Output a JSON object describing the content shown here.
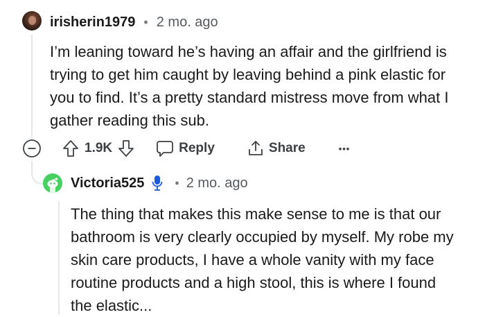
{
  "comment": {
    "username": "irisherin1979",
    "time": "2 mo. ago",
    "body": "I’m leaning toward he’s having an affair and the girlfriend is trying to get him caught by leaving behind a pink elastic for you to find. It’s a pretty standard mistress move from what I gather reading this sub.",
    "votes": "1.9K",
    "reply_label": "Reply",
    "share_label": "Share",
    "more_label": "•••"
  },
  "reply": {
    "username": "Victoria525",
    "time": "2 mo. ago",
    "body": "The thing that makes this make sense to me is that our bathroom is very clearly occupied by myself. My robe my skin care products, I have a whole vanity with my face routine products and a high stool, this is where I found the elastic..."
  },
  "colors": {
    "text": "#1a1a1b",
    "muted": "#555a5e",
    "thread": "#e5e7ea",
    "badge_blue": "#1e5bd8",
    "avatar_green": "#46d160"
  },
  "icons": [
    "collapse-icon",
    "upvote-icon",
    "downvote-icon",
    "reply-icon",
    "share-icon",
    "more-icon",
    "avatar-icon",
    "badge-icon"
  ]
}
